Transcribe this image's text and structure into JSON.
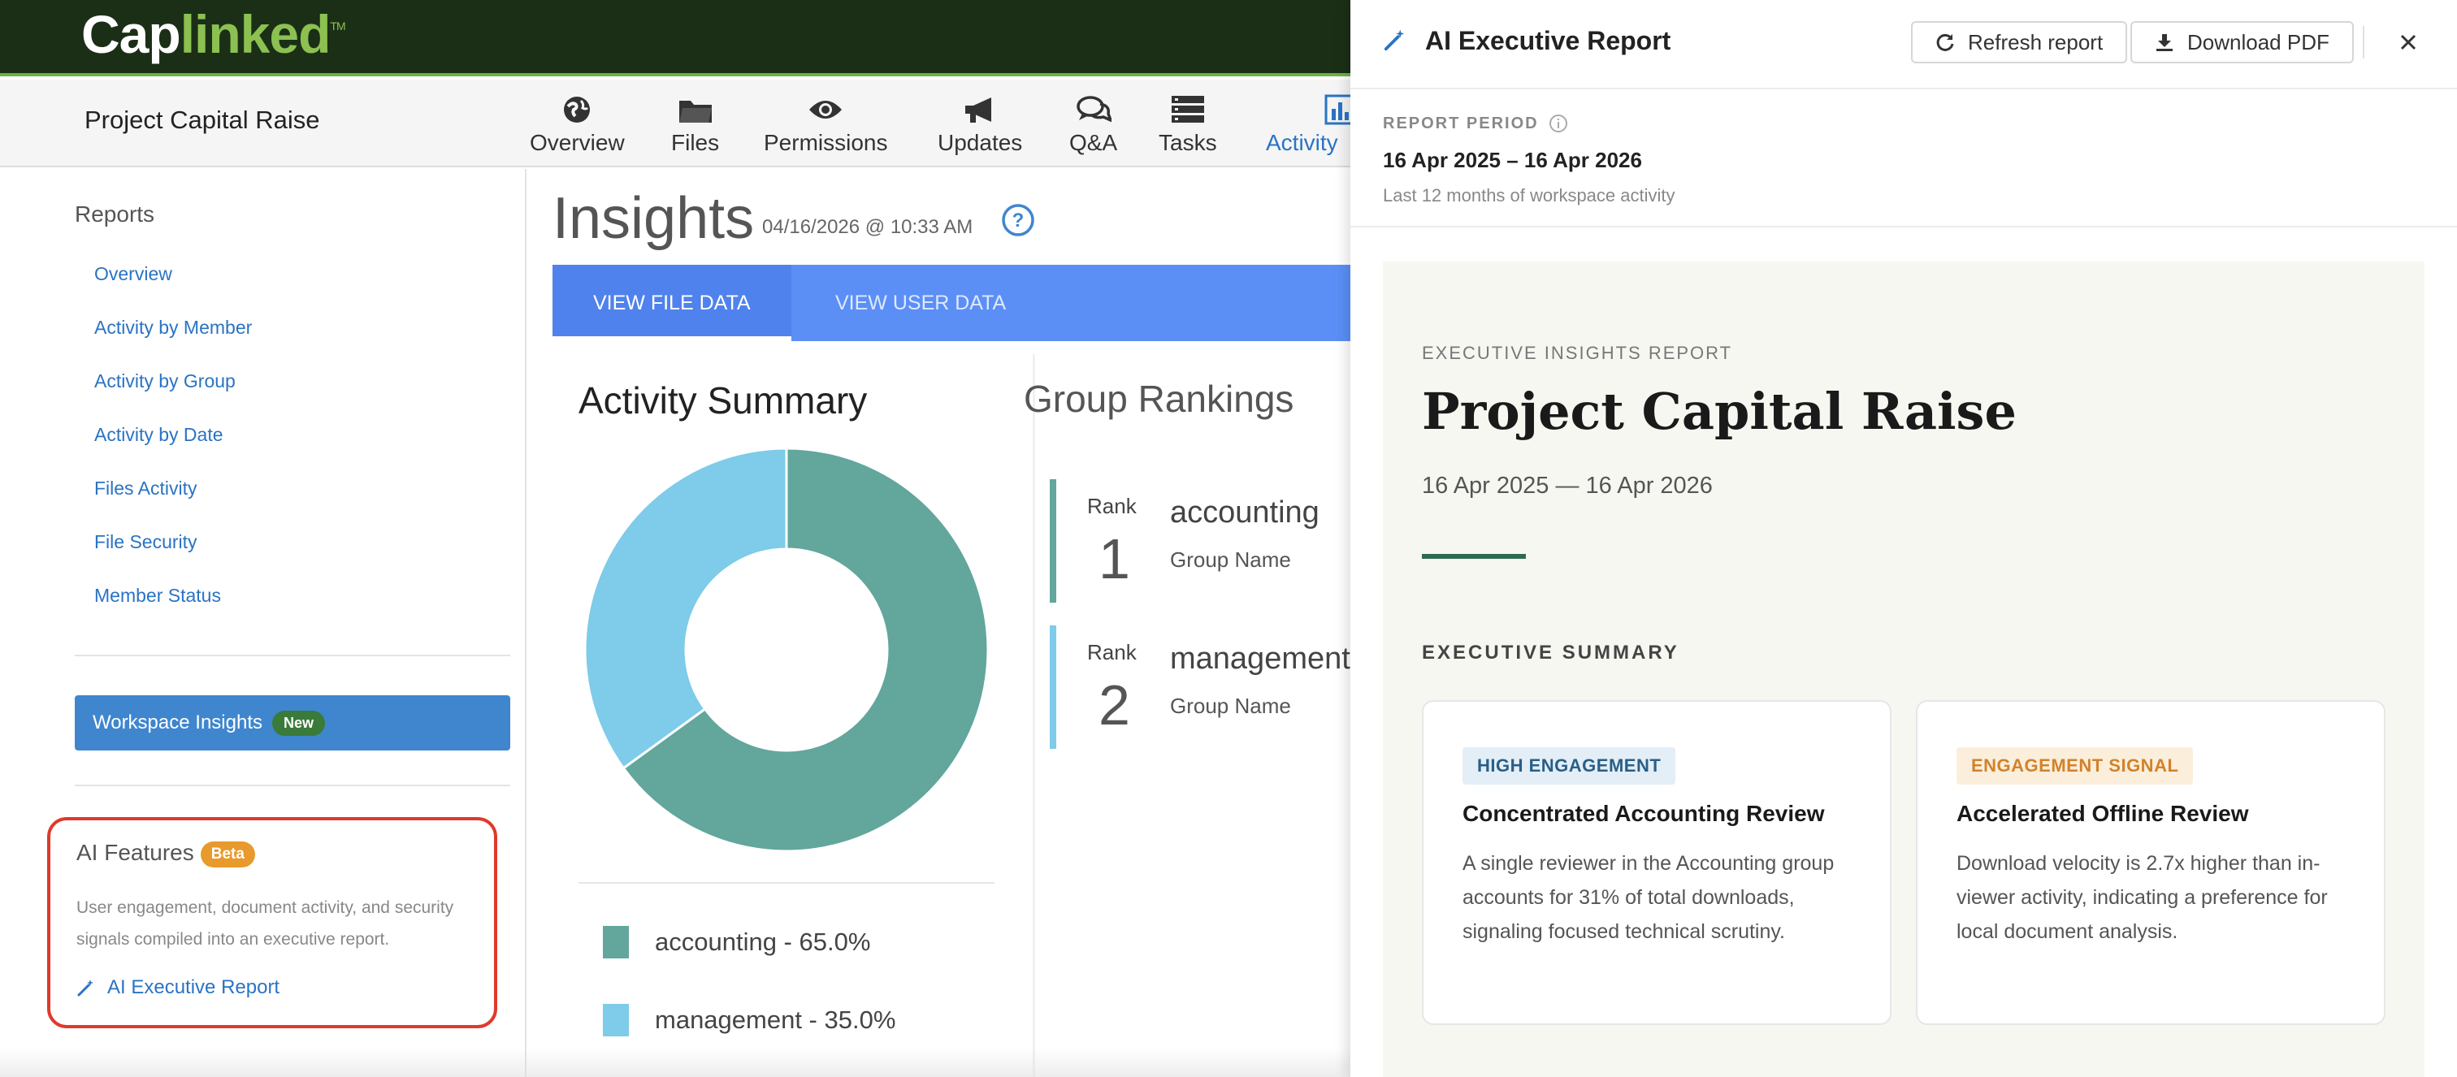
{
  "brand": {
    "logo_white": "Cap",
    "logo_green": "linked",
    "logo_tm": "TM"
  },
  "navbar": {
    "project_title": "Project Capital Raise",
    "items": [
      {
        "label": "Overview",
        "icon": "globe-icon"
      },
      {
        "label": "Files",
        "icon": "folder-icon"
      },
      {
        "label": "Permissions",
        "icon": "eye-icon"
      },
      {
        "label": "Updates",
        "icon": "megaphone-icon"
      },
      {
        "label": "Q&A",
        "icon": "chat-bubbles-icon"
      },
      {
        "label": "Tasks",
        "icon": "tasks-icon"
      },
      {
        "label": "Activity",
        "icon": "bar-chart-icon",
        "active": true
      }
    ]
  },
  "sidebar": {
    "heading": "Reports",
    "links": [
      "Overview",
      "Activity by Member",
      "Activity by Group",
      "Activity by Date",
      "Files Activity",
      "File Security",
      "Member Status"
    ],
    "workspace_insights": {
      "label": "Workspace Insights",
      "badge": "New"
    },
    "ai_features": {
      "heading": "AI Features",
      "badge": "Beta",
      "description": "User engagement, document activity, and security signals compiled into an executive report.",
      "link": "AI Executive Report"
    }
  },
  "main": {
    "title": "Insights",
    "timestamp": "04/16/2026 @ 10:33 AM",
    "tabs": [
      {
        "label": "VIEW FILE DATA",
        "active": true
      },
      {
        "label": "VIEW USER DATA",
        "active": false
      }
    ],
    "activity_summary": {
      "title": "Activity Summary",
      "legend": [
        {
          "label": "accounting - 65.0%",
          "color": "#62a69c"
        },
        {
          "label": "management - 35.0%",
          "color": "#7ecbea"
        }
      ]
    },
    "group_rankings": {
      "title": "Group Rankings",
      "rank_label": "Rank",
      "sub_label": "Group Name",
      "items": [
        {
          "rank": "1",
          "name": "accounting",
          "color": "#62a69c"
        },
        {
          "rank": "2",
          "name": "management",
          "color": "#7ecbea"
        }
      ]
    }
  },
  "chart_data": {
    "type": "pie",
    "title": "Activity Summary",
    "categories": [
      "accounting",
      "management"
    ],
    "values": [
      65.0,
      35.0
    ],
    "colors": [
      "#62a69c",
      "#7ecbea"
    ],
    "donut": true,
    "legend": "bottom"
  },
  "drawer": {
    "title": "AI Executive Report",
    "refresh_label": "Refresh report",
    "download_label": "Download PDF",
    "period_label": "REPORT PERIOD",
    "period_value": "16 Apr 2025 – 16 Apr 2026",
    "period_note": "Last 12 months of workspace activity",
    "report": {
      "kicker": "EXECUTIVE INSIGHTS REPORT",
      "title": "Project Capital Raise",
      "dates": "16 Apr 2025 — 16 Apr 2026",
      "summary_heading": "EXECUTIVE SUMMARY",
      "cards": [
        {
          "badge": "HIGH ENGAGEMENT",
          "badge_color": "#2a5f86",
          "badge_bg": "#e3eef7",
          "title": "Concentrated Accounting Review",
          "body": "A single reviewer in the Accounting group accounts for 31% of total downloads, signaling focused technical scrutiny."
        },
        {
          "badge": "ENGAGEMENT SIGNAL",
          "badge_color": "#d3822a",
          "badge_bg": "#fbefdc",
          "title": "Accelerated Offline Review",
          "body": "Download velocity is 2.7x higher than in-viewer activity, indicating a preference for local document analysis."
        }
      ]
    }
  },
  "colors": {
    "brand_dark": "#1b2f16",
    "brand_green": "#8cc152",
    "link_blue": "#2a73c4",
    "tab_blue": "#5b8ff6",
    "highlight_red": "#e0392b"
  }
}
